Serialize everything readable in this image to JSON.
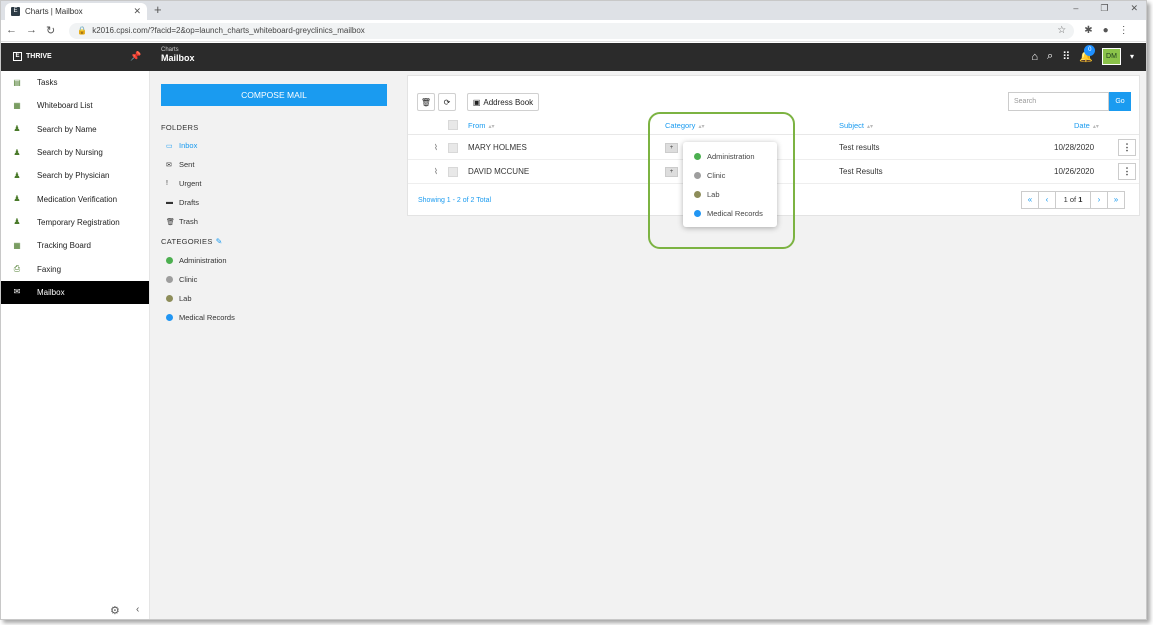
{
  "browser": {
    "tab_title": "Charts | Mailbox",
    "tab_favicon": "E",
    "url": "k2016.cpsi.com/?facid=2&op=launch_charts_whiteboard-greyclinics_mailbox"
  },
  "appbar": {
    "brand": "THRIVE",
    "brand_logo": "E",
    "crumb_small": "Charts",
    "crumb_big": "Mailbox",
    "notification_count": "0",
    "avatar_initials": "DM"
  },
  "sidenav": {
    "items": [
      {
        "label": "Tasks",
        "icon": "clipboard-icon"
      },
      {
        "label": "Whiteboard List",
        "icon": "list-icon"
      },
      {
        "label": "Search by Name",
        "icon": "person-search-icon"
      },
      {
        "label": "Search by Nursing",
        "icon": "nurse-icon"
      },
      {
        "label": "Search by Physician",
        "icon": "physician-icon"
      },
      {
        "label": "Medication Verification",
        "icon": "medication-icon"
      },
      {
        "label": "Temporary Registration",
        "icon": "registration-icon"
      },
      {
        "label": "Tracking Board",
        "icon": "board-icon"
      },
      {
        "label": "Faxing",
        "icon": "fax-icon"
      },
      {
        "label": "Mailbox",
        "icon": "mailbox-icon"
      }
    ]
  },
  "mailpanel": {
    "compose_label": "COMPOSE MAIL",
    "folders_title": "FOLDERS",
    "folders": [
      {
        "label": "Inbox",
        "icon": "inbox-icon"
      },
      {
        "label": "Sent",
        "icon": "envelope-icon"
      },
      {
        "label": "Urgent",
        "icon": "exclamation-icon"
      },
      {
        "label": "Drafts",
        "icon": "draft-icon"
      },
      {
        "label": "Trash",
        "icon": "trash-icon"
      }
    ],
    "categories_title": "CATEGORIES",
    "categories": [
      {
        "label": "Administration",
        "color": "#4caf50"
      },
      {
        "label": "Clinic",
        "color": "#9e9e9e"
      },
      {
        "label": "Lab",
        "color": "#8d8d5a"
      },
      {
        "label": "Medical Records",
        "color": "#2196f3"
      }
    ]
  },
  "maillist": {
    "address_book_label": "Address Book",
    "search_placeholder": "Search",
    "go_label": "Go",
    "columns": {
      "from": "From",
      "category": "Category",
      "subject": "Subject",
      "date": "Date"
    },
    "rows": [
      {
        "from": "MARY HOLMES",
        "subject": "Test results",
        "date": "10/28/2020"
      },
      {
        "from": "DAVID MCCUNE",
        "subject": "Test Results",
        "date": "10/26/2020"
      }
    ],
    "showing_text": "Showing 1 - 2 of 2 Total",
    "page_current": "1",
    "page_of": "of",
    "page_total": "1"
  },
  "category_dropdown": {
    "items": [
      {
        "label": "Administration",
        "color": "#4caf50"
      },
      {
        "label": "Clinic",
        "color": "#9e9e9e"
      },
      {
        "label": "Lab",
        "color": "#8d8d5a"
      },
      {
        "label": "Medical Records",
        "color": "#2196f3"
      }
    ],
    "highlight_color": "#7cb342"
  }
}
